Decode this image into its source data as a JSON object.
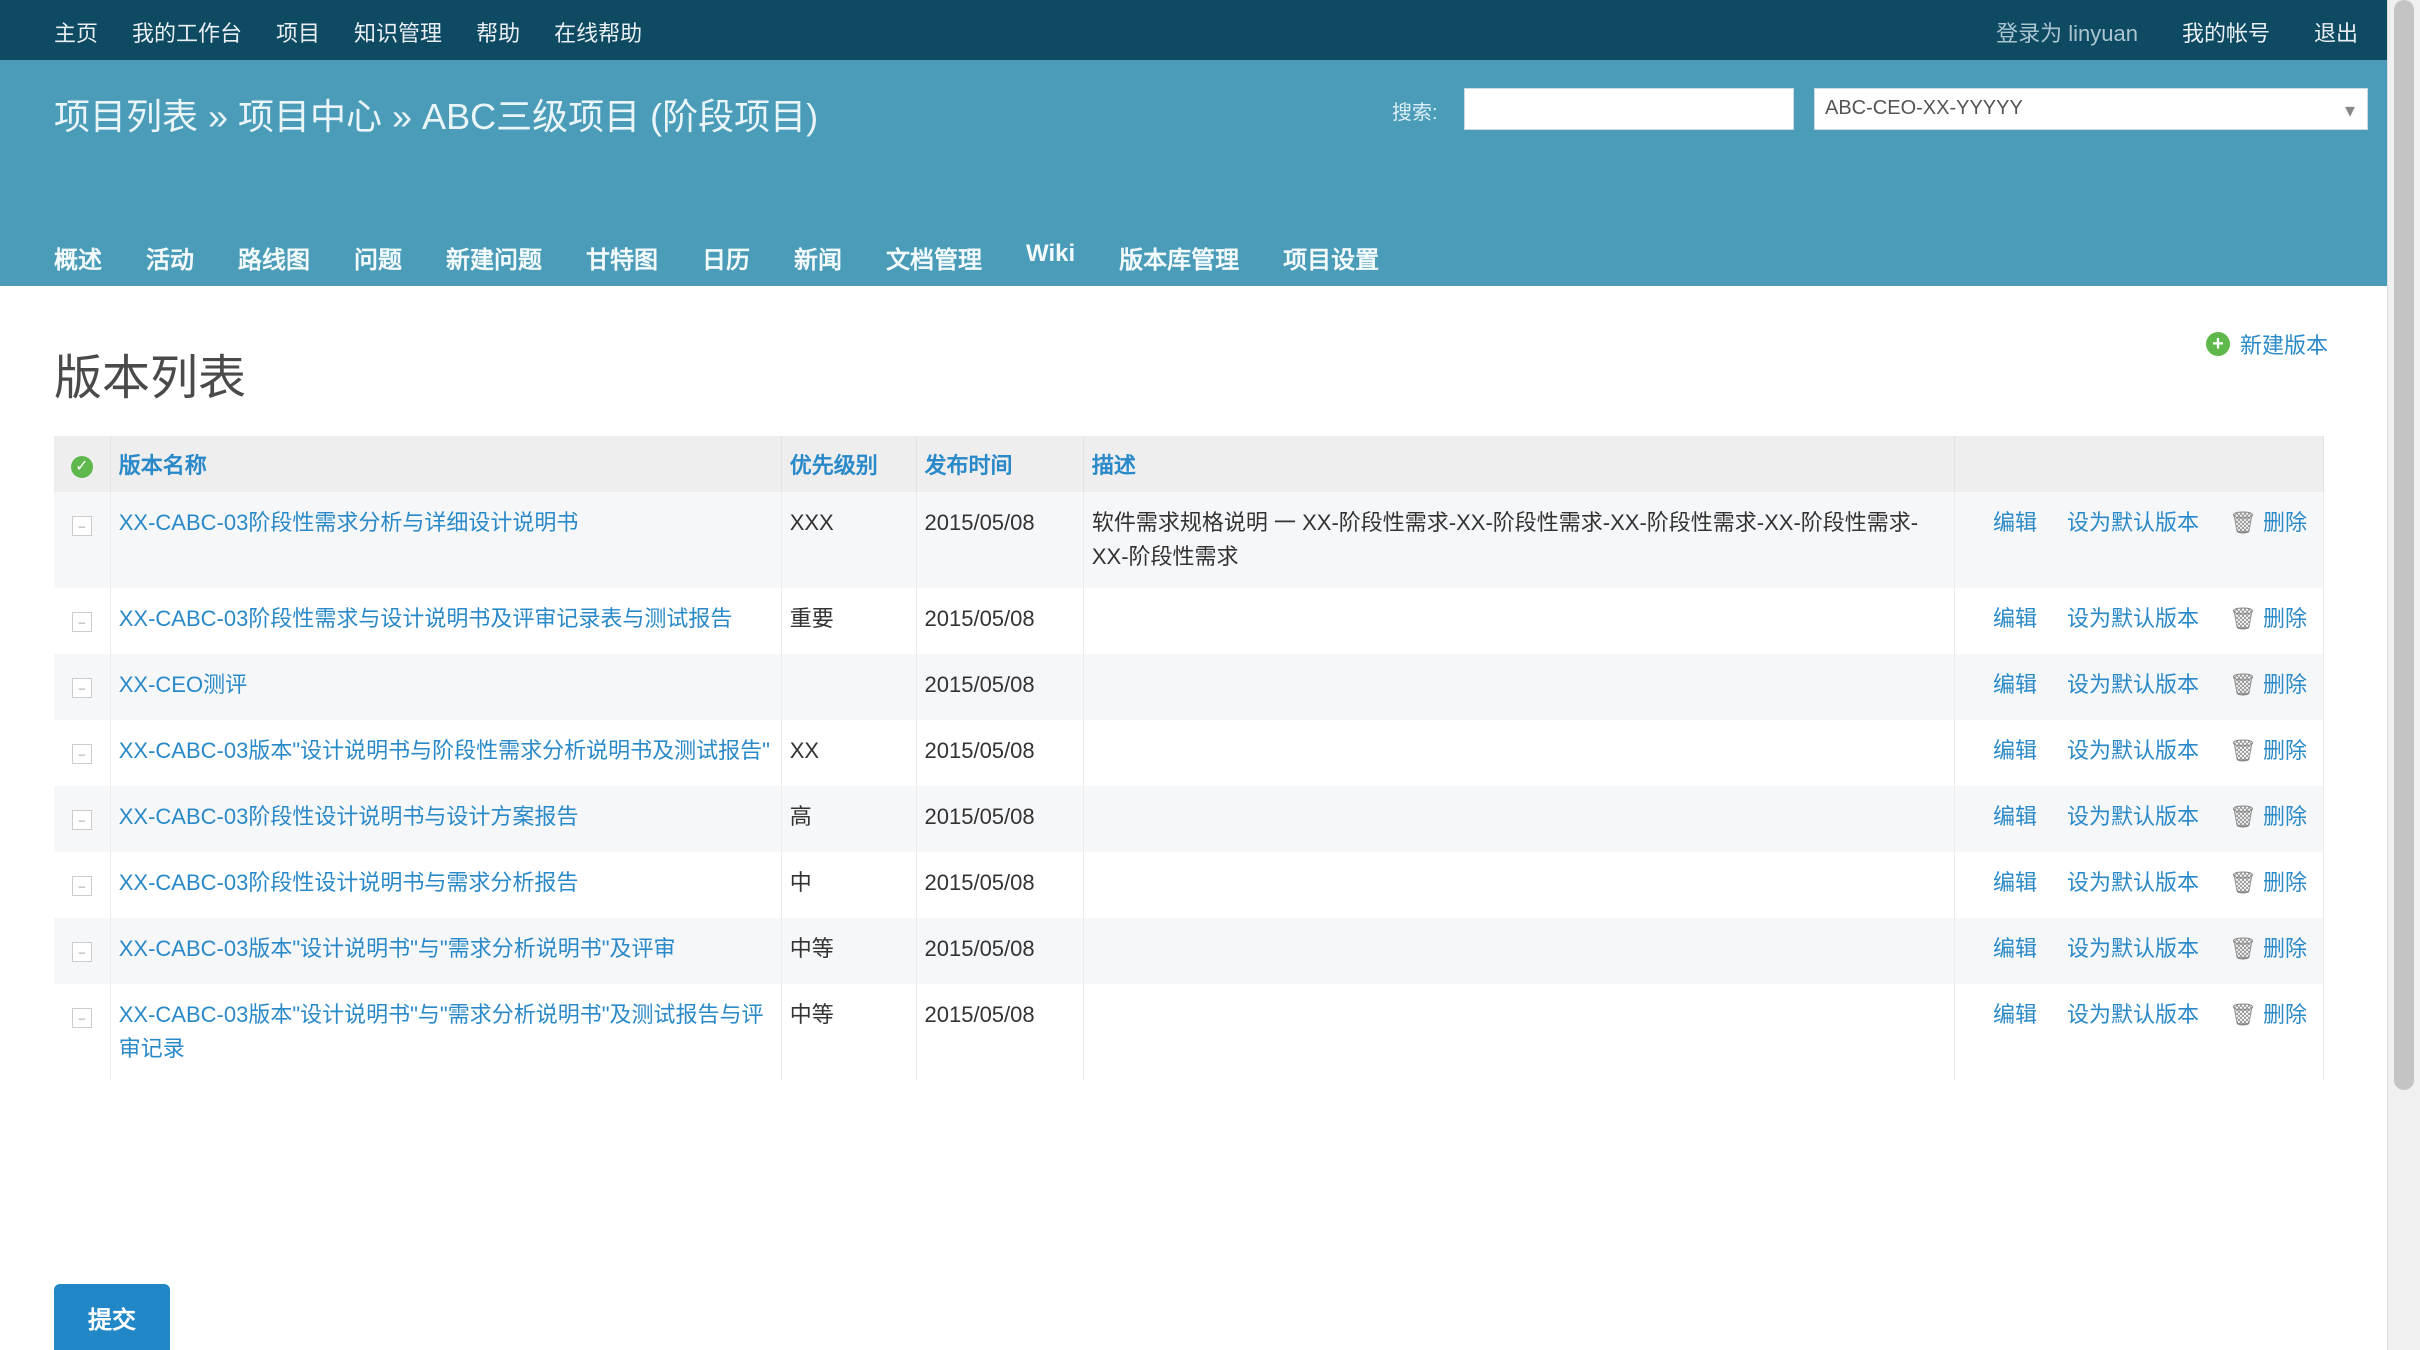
{
  "top_menu": {
    "items": [
      "主页",
      "我的工作台",
      "项目",
      "知识管理",
      "帮助",
      "在线帮助"
    ],
    "logged_in": "登录为 linyuan",
    "my_account": "我的帐号",
    "logout": "退出"
  },
  "header": {
    "project_title": "项目列表 » 项目中心 » ABC三级项目 (阶段项目)",
    "search_label": "搜索:",
    "search_value": "",
    "project_jump": "ABC-CEO-XX-YYYYY"
  },
  "main_menu": [
    "概述",
    "活动",
    "路线图",
    "问题",
    "新建问题",
    "甘特图",
    "日历",
    "新闻",
    "文档管理",
    "Wiki",
    "版本库管理",
    "项目设置"
  ],
  "page": {
    "title": "版本列表",
    "new_link": "新建版本"
  },
  "table": {
    "headers": {
      "subject": "版本名称",
      "priority": "优先级别",
      "time": "发布时间",
      "note": "描述",
      "actions": ""
    },
    "rows": [
      {
        "subject": "XX-CABC-03阶段性需求分析与详细设计说明书",
        "priority": "XXX",
        "time": "2015/05/08",
        "note": "软件需求规格说明 一 XX-阶段性需求-XX-阶段性需求-XX-阶段性需求-XX-阶段性需求-XX-阶段性需求",
        "edit": "编辑",
        "set": "设为默认版本",
        "delete": "删除"
      },
      {
        "subject": "XX-CABC-03阶段性需求与设计说明书及评审记录表与测试报告",
        "priority": "重要",
        "time": "2015/05/08",
        "note": "",
        "edit": "编辑",
        "set": "设为默认版本",
        "delete": "删除"
      },
      {
        "subject": "XX-CEO测评",
        "priority": "",
        "time": "2015/05/08",
        "note": "",
        "edit": "编辑",
        "set": "设为默认版本",
        "delete": "删除"
      },
      {
        "subject": "XX-CABC-03版本\"设计说明书与阶段性需求分析说明书及测试报告\"",
        "priority": "XX",
        "time": "2015/05/08",
        "note": "",
        "edit": "编辑",
        "set": "设为默认版本",
        "delete": "删除"
      },
      {
        "subject": "XX-CABC-03阶段性设计说明书与设计方案报告",
        "priority": "高",
        "time": "2015/05/08",
        "note": "",
        "edit": "编辑",
        "set": "设为默认版本",
        "delete": "删除"
      },
      {
        "subject": "XX-CABC-03阶段性设计说明书与需求分析报告",
        "priority": "中",
        "time": "2015/05/08",
        "note": "",
        "edit": "编辑",
        "set": "设为默认版本",
        "delete": "删除"
      },
      {
        "subject": "XX-CABC-03版本\"设计说明书\"与\"需求分析说明书\"及评审",
        "priority": "中等",
        "time": "2015/05/08",
        "note": "",
        "edit": "编辑",
        "set": "设为默认版本",
        "delete": "删除"
      },
      {
        "subject": "XX-CABC-03版本\"设计说明书\"与\"需求分析说明书\"及测试报告与评审记录",
        "priority": "中等",
        "time": "2015/05/08",
        "note": "",
        "edit": "编辑",
        "set": "设为默认版本",
        "delete": "删除"
      }
    ]
  },
  "buttons": {
    "apply": "提交"
  },
  "icons": {
    "check": "check-circle-icon",
    "plus": "plus-circle-icon",
    "delete": "trash-icon",
    "toggle": "expand-toggle-icon",
    "dropdown": "chevron-down-icon"
  },
  "colors": {
    "top_bar": "#0e4a62",
    "header": "#4a9cb8",
    "link": "#2a89c8",
    "button": "#2287c7",
    "accent_green": "#5fb84c"
  }
}
